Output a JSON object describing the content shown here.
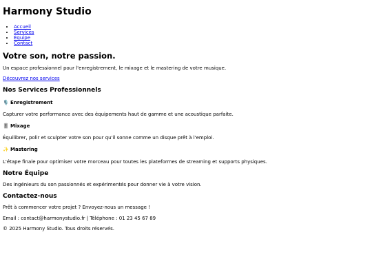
{
  "header": {
    "title": "Harmony Studio"
  },
  "nav": {
    "items": [
      {
        "label": "Accueil"
      },
      {
        "label": "Services"
      },
      {
        "label": "Équipe"
      },
      {
        "label": "Contact"
      }
    ]
  },
  "hero": {
    "title": "Votre son, notre passion.",
    "subtitle": "Un espace professionnel pour l'enregistrement, le mixage et le mastering de votre musique.",
    "cta_label": "Découvrez nos services"
  },
  "services": {
    "heading": "Nos Services Professionnels",
    "items": [
      {
        "icon": "🎙️",
        "icon_name": "microphone-icon",
        "title": "Enregistrement",
        "description": "Capturer votre performance avec des équipements haut de gamme et une acoustique parfaite."
      },
      {
        "icon": "🎚️",
        "icon_name": "mixer-slider-icon",
        "title": "Mixage",
        "description": "Équilibrer, polir et sculpter votre son pour qu'il sonne comme un disque prêt à l'emploi."
      },
      {
        "icon": "✨",
        "icon_name": "sparkles-icon",
        "title": "Mastering",
        "description": "L'étape finale pour optimiser votre morceau pour toutes les plateformes de streaming et supports physiques."
      }
    ]
  },
  "team": {
    "heading": "Notre Équipe",
    "description": "Des ingénieurs du son passionnés et expérimentés pour donner vie à votre vision."
  },
  "contact": {
    "heading": "Contactez-nous",
    "intro": "Prêt à commencer votre projet ? Envoyez-nous un message !",
    "details": "Email : contact@harmonystudio.fr | Téléphone : 01 23 45 67 89"
  },
  "footer": {
    "copyright": "© 2025 Harmony Studio. Tous droits réservés."
  },
  "colors": {
    "link": "#0000ee",
    "text": "#000000",
    "background": "#ffffff"
  }
}
